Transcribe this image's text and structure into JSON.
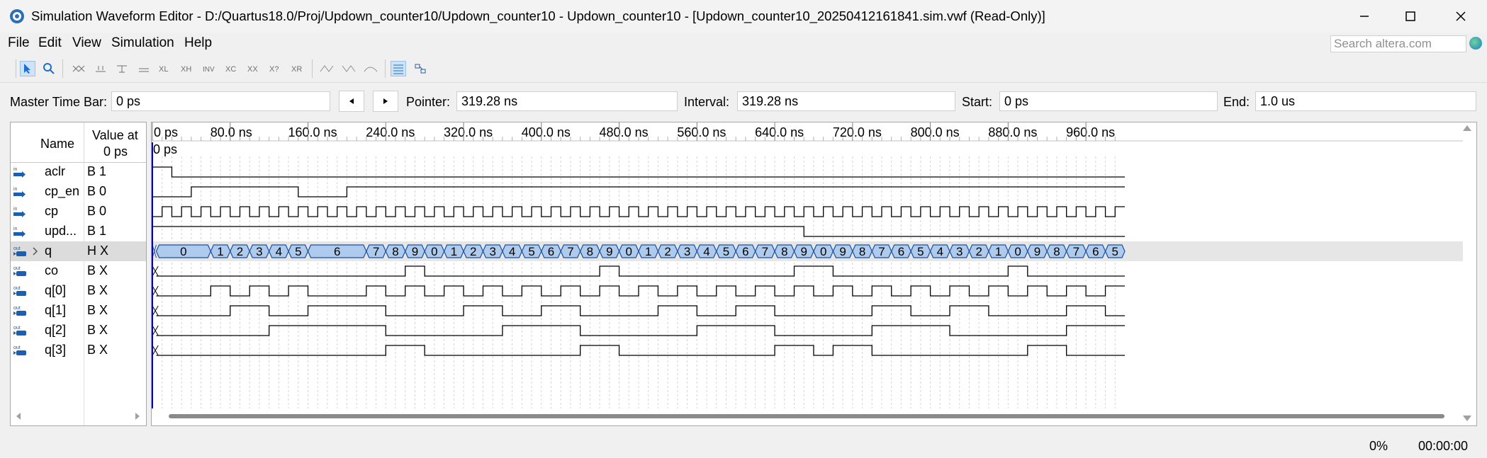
{
  "window": {
    "title": "Simulation Waveform Editor - D:/Quartus18.0/Proj/Updown_counter10/Updown_counter10 - Updown_counter10 - [Updown_counter10_20250412161841.sim.vwf (Read-Only)]",
    "minimize_icon": "minimize-icon",
    "maximize_icon": "maximize-icon",
    "close_icon": "close-icon"
  },
  "menu": {
    "items": [
      "File",
      "Edit",
      "View",
      "Simulation",
      "Help"
    ]
  },
  "search": {
    "placeholder": "Search altera.com"
  },
  "toolbar": {
    "icons": [
      "pointer-tool-icon",
      "zoom-tool-icon",
      "forcing-unknown-icon",
      "forcing-low-icon",
      "forcing-high-icon",
      "high-impedance-icon",
      "weak-low-icon",
      "weak-high-icon",
      "dont-care-icon",
      "invert-icon",
      "count-value-icon",
      "clock-icon",
      "arbitrary-value-icon",
      "random-value-icon",
      "run-functional-icon",
      "run-timing-icon",
      "generate-netlist-icon",
      "snap-to-grid-icon",
      "grid-settings-icon"
    ]
  },
  "timebar": {
    "master_label": "Master Time Bar:",
    "master_value": "0 ps",
    "pointer_label": "Pointer:",
    "pointer_value": "319.28 ns",
    "interval_label": "Interval:",
    "interval_value": "319.28 ns",
    "start_label": "Start:",
    "start_value": "0 ps",
    "end_label": "End:",
    "end_value": "1.0 us"
  },
  "signal_table": {
    "header_name": "Name",
    "header_value": "Value at",
    "header_value_time": "0 ps",
    "signals": [
      {
        "dir": "in",
        "name": "aclr",
        "value": "B 1"
      },
      {
        "dir": "in",
        "name": "cp_en",
        "value": "B 0"
      },
      {
        "dir": "in",
        "name": "cp",
        "value": "B 0"
      },
      {
        "dir": "in",
        "name": "upd...",
        "value": "B 1"
      },
      {
        "dir": "out",
        "name": "q",
        "value": "H X"
      },
      {
        "dir": "out",
        "name": "co",
        "value": "B X"
      },
      {
        "dir": "out",
        "name": "q[0]",
        "value": "B X"
      },
      {
        "dir": "out",
        "name": "q[1]",
        "value": "B X"
      },
      {
        "dir": "out",
        "name": "q[2]",
        "value": "B X"
      },
      {
        "dir": "out",
        "name": "q[3]",
        "value": "B X"
      }
    ]
  },
  "waveform": {
    "time_labels": [
      "0 ps",
      "80.0 ns",
      "160.0 ns",
      "240.0 ns",
      "320.0 ns",
      "400.0 ns",
      "480.0 ns",
      "560.0 ns",
      "640.0 ns",
      "720.0 ns",
      "800.0 ns",
      "880.0 ns",
      "960.0 ns"
    ],
    "cursor_label": "0 ps",
    "q_values": [
      "0",
      "1",
      "2",
      "3",
      "4",
      "5",
      "6",
      "7",
      "8",
      "9",
      "0",
      "1",
      "2",
      "3",
      "4",
      "5",
      "6",
      "7",
      "8",
      "9",
      "0",
      "1",
      "2",
      "3",
      "4",
      "5",
      "6",
      "7",
      "8",
      "9",
      "0",
      "9",
      "8",
      "7",
      "6",
      "5",
      "4",
      "3",
      "2",
      "1",
      "0",
      "9",
      "8",
      "7",
      "6",
      "5"
    ],
    "bus_color": "#aecbee",
    "cursor_color": "#0000c0"
  },
  "status": {
    "progress": "0%",
    "elapsed": "00:00:00"
  }
}
